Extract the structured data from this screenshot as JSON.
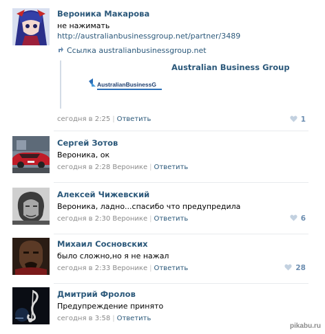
{
  "comments": [
    {
      "author": "Вероника Макарова",
      "text": "не нажимать",
      "url": "http://australianbusinessgroup.net/partner/3489",
      "snippet_link": "Ссылка australianbusinessgroup.net",
      "snippet_title": "Australian Business Group",
      "snippet_logo_text": "AustralianBusinessG",
      "time": "сегодня в 2:25",
      "reply_to": "",
      "reply_label": "Ответить",
      "likes": "1"
    },
    {
      "author": "Сергей Зотов",
      "text": "Вероника, ок",
      "time": "сегодня в 2:28",
      "reply_to": "Веронике",
      "reply_label": "Ответить",
      "likes": ""
    },
    {
      "author": "Алексей Чижевский",
      "text": "Вероника, ладно...спасибо что предупредила",
      "time": "сегодня в 2:30",
      "reply_to": "Веронике",
      "reply_label": "Ответить",
      "likes": "6"
    },
    {
      "author": "Михаил Сосновских",
      "text": "было сложно,но я не нажал",
      "time": "сегодня в 2:33",
      "reply_to": "Веронике",
      "reply_label": "Ответить",
      "likes": "28"
    },
    {
      "author": "Дмитрий Фролов",
      "text": "Предупреждение принято",
      "time": "сегодня в 3:58",
      "reply_to": "",
      "reply_label": "Ответить",
      "likes": ""
    }
  ],
  "watermark": "pikabu.ru",
  "colors": {
    "link": "#2b587a",
    "meta": "#8a8a8a",
    "like": "#6b8db0",
    "divider": "#e7eaed"
  },
  "icons": {
    "like": "heart-icon",
    "snippet": "share-arrow-icon"
  }
}
